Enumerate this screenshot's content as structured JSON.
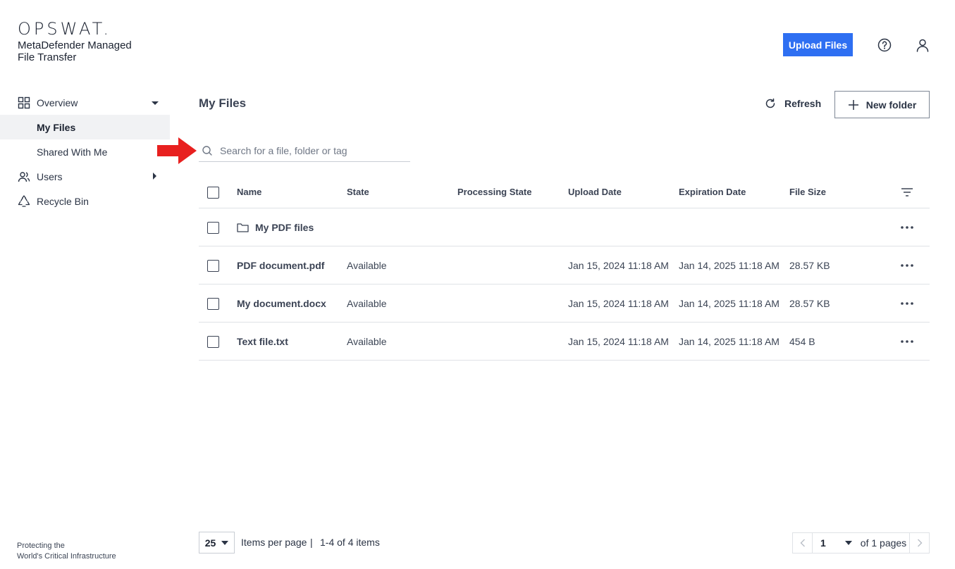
{
  "brand": {
    "logo": "OPSWAT.",
    "product_line1": "MetaDefender Managed",
    "product_line2": "File Transfer",
    "footer_line1": "Protecting the",
    "footer_line2": "World's Critical Infrastructure"
  },
  "header": {
    "upload_label": "Upload Files",
    "help_icon": "question-circle-icon",
    "user_icon": "user-icon"
  },
  "sidebar": {
    "items": [
      {
        "label": "Overview",
        "icon": "grid-icon",
        "caret": "down"
      },
      {
        "label": "My Files",
        "active": true
      },
      {
        "label": "Shared With Me"
      },
      {
        "label": "Users",
        "icon": "users-icon",
        "caret": "right"
      },
      {
        "label": "Recycle Bin",
        "icon": "recycle-icon"
      }
    ]
  },
  "main": {
    "title": "My Files",
    "refresh_label": "Refresh",
    "new_folder_label": "New folder",
    "search_placeholder": "Search for a file, folder or tag"
  },
  "table": {
    "columns": [
      "Name",
      "State",
      "Processing State",
      "Upload Date",
      "Expiration Date",
      "File Size"
    ],
    "rows": [
      {
        "name": "My PDF files",
        "type": "folder",
        "state": "",
        "processing": "",
        "upload": "",
        "expiration": "",
        "size": ""
      },
      {
        "name": "PDF document.pdf",
        "type": "file",
        "state": "Available",
        "processing": "",
        "upload": "Jan 15, 2024 11:18 AM",
        "expiration": "Jan 14, 2025 11:18 AM",
        "size": "28.57 KB"
      },
      {
        "name": "My document.docx",
        "type": "file",
        "state": "Available",
        "processing": "",
        "upload": "Jan 15, 2024 11:18 AM",
        "expiration": "Jan 14, 2025 11:18 AM",
        "size": "28.57 KB"
      },
      {
        "name": "Text file.txt",
        "type": "file",
        "state": "Available",
        "processing": "",
        "upload": "Jan 15, 2024 11:18 AM",
        "expiration": "Jan 14, 2025 11:18 AM",
        "size": "454 B"
      }
    ]
  },
  "pagination": {
    "per_page": "25",
    "per_page_label": "Items per page",
    "separator": "|",
    "range": "1-4 of 4 items",
    "current_page": "1",
    "of_pages": "of 1 pages"
  },
  "colors": {
    "accent": "#2e6ff2",
    "annotation_arrow": "#e8201f"
  }
}
